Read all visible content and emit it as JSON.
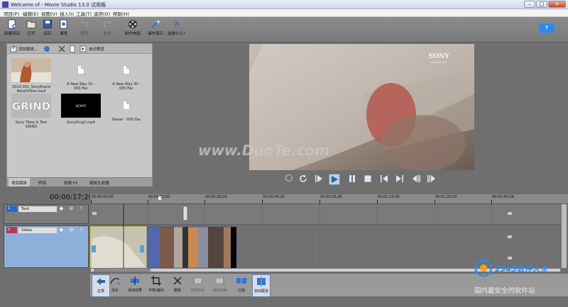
{
  "window": {
    "title": "Welcome.vf - Movie Studio 13.0 试用版",
    "controls": {
      "minimize": "–",
      "maximize": "□",
      "close": "✕"
    }
  },
  "menubar": [
    "项目(P)",
    "编辑(E)",
    "视图(V)",
    "插入(I)",
    "工具(T)",
    "选项(O)",
    "帮助(H)"
  ],
  "toolbar": {
    "new_project": "新建项目",
    "open": "打开",
    "save": "保存",
    "properties": "属性",
    "undo": "撤销",
    "redo": "重做",
    "make_movie": "制作电影",
    "show_me_how": "操作演示",
    "whats_this": "这是什么?",
    "help": "?"
  },
  "media": {
    "import_media": "添加媒体...",
    "auto_preview": "自动预览",
    "items": [
      {
        "name": "2012-051_SonyBrand RetailVideo.mp4",
        "kind": "video-beach"
      },
      {
        "name": "A New Way 10 - 000.flac",
        "kind": "audio"
      },
      {
        "name": "A New Way 30 - 000.flac",
        "kind": "audio"
      },
      {
        "name": "Sony Titles & Text GRIND",
        "kind": "title"
      },
      {
        "name": "SonyDing2.mp4",
        "kind": "video-black"
      },
      {
        "name": "Teaser - 000.flac",
        "kind": "audio"
      }
    ],
    "tabs": [
      "项目媒体",
      "转场",
      "视频 FX",
      "媒体生成器"
    ],
    "thumb_grind": "GRIND",
    "thumb_sony": "SONY"
  },
  "preview": {
    "brand": "SONY",
    "brand_sub": "make.believe"
  },
  "watermark": "www.DuoTe.com",
  "timeline": {
    "timecode": "00:00:17;29",
    "ruler": [
      "00:00:00;00",
      "00:00:15;00",
      "00:00:29;29",
      "00:00:44;29",
      "00:00:59;28",
      "00:01:14;28",
      "00:01:29;29",
      "00:01:44;29"
    ],
    "tracks": [
      {
        "num": "1",
        "name": "Text",
        "color": "#2d66c4"
      },
      {
        "num": "2",
        "name": "Video",
        "color": "#b23a4f"
      }
    ]
  },
  "bottombar": {
    "normal": "正常",
    "envelope": "流化",
    "add_effects": "添加效果",
    "pan_crop": "平移/裁切",
    "delete": "删除",
    "trim_start": "修剪开始",
    "trim_end": "修剪结束",
    "split": "分割",
    "auto_ripple": "自动跟进"
  },
  "badge": {
    "site": "2345软件大全",
    "tagline": "国内最安全的软件站"
  },
  "colors": {
    "accent": "#2a8be8",
    "transport": "#d9e7f7",
    "timeline_bg": "#767676"
  }
}
